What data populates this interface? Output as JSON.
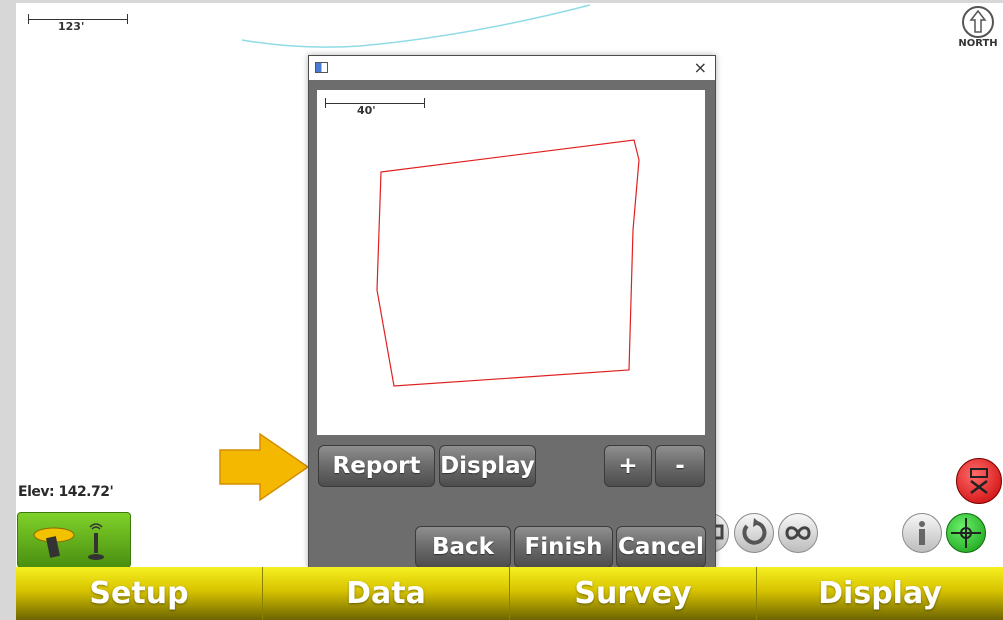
{
  "map": {
    "scale_label": "123'",
    "north_label": "NORTH",
    "elevation": "Elev: 142.72'"
  },
  "dialog": {
    "scale_label": "40'",
    "buttons": {
      "report": "Report",
      "display": "Display",
      "zoom_in": "+",
      "zoom_out": "-",
      "back": "Back",
      "finish": "Finish",
      "cancel": "Cancel"
    },
    "close_glyph": "×"
  },
  "bottom_tabs": [
    {
      "label": "Setup"
    },
    {
      "label": "Data"
    },
    {
      "label": "Survey"
    },
    {
      "label": "Display"
    }
  ],
  "icons": {
    "gps": "gps-receiver-icon",
    "north": "north-arrow-icon",
    "stop": "stop-icon",
    "info": "info-icon",
    "target": "crosshair-icon",
    "rotate": "rotate-icon",
    "infinity": "infinity-icon"
  },
  "colors": {
    "accent_yellow": "#e6d800",
    "polygon_red": "#e02020",
    "arrow_orange": "#f5b800",
    "target_green": "#1ec21e"
  }
}
